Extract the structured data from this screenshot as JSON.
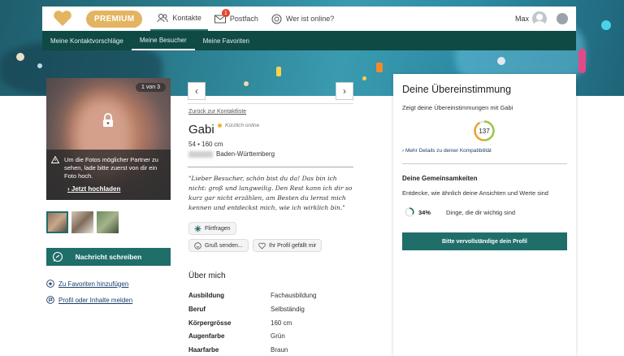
{
  "topnav": {
    "premium_label": "PREMIUM",
    "items": [
      {
        "label": "Kontakte"
      },
      {
        "label": "Postfach",
        "badge": "1"
      },
      {
        "label": "Wer ist online?"
      }
    ],
    "user_name": "Max"
  },
  "subnav": {
    "items": [
      {
        "label": "Meine Kontaktvorschläge"
      },
      {
        "label": "Meine Besucher"
      },
      {
        "label": "Meine Favoriten"
      }
    ]
  },
  "photo": {
    "counter": "1 von 3",
    "info_text": "Um die Fotos möglicher Partner zu sehen, lade bitte zuerst von dir ein Foto hoch.",
    "upload_label": "Jetzt hochladen"
  },
  "actions": {
    "message_button": "Nachricht schreiben",
    "favorite_link": "Zu Favoriten hinzufügen",
    "report_link": "Profil oder Inhalte melden"
  },
  "profile": {
    "back_link": "Zurück zur Kontaktliste",
    "name": "Gabi",
    "status": "Kürzlich online",
    "meta": "54 • 160 cm",
    "location": "Baden-Württemberg",
    "quote": "\"Lieber Besucher, schön bist du da! Das bin ich nicht: groß und langweilig. Den Rest kann ich dir so kurz gar nicht erzählen, am Besten du lernst mich kennen und entdeckst mich, wie ich wirklich bin.\"",
    "chips": {
      "flirt": "Flirtfragen",
      "greet": "Gruß senden...",
      "like": "Ihr Profil gefällt mir"
    },
    "about_heading": "Über mich",
    "details": [
      {
        "key": "Ausbildung",
        "value": "Fachausbildung"
      },
      {
        "key": "Beruf",
        "value": "Selbständig"
      },
      {
        "key": "Körpergrösse",
        "value": "160 cm"
      },
      {
        "key": "Augenfarbe",
        "value": "Grün"
      },
      {
        "key": "Haarfarbe",
        "value": "Braun"
      }
    ]
  },
  "match_panel": {
    "title": "Deine Übereinstimmung",
    "subtitle": "Zeigt deine Übereinstimmungen mit Gabi",
    "score": "137",
    "more_link": "Mehr Details zu deiner Kompatibilität",
    "common_heading": "Deine Gemeinsamkeiten",
    "common_desc": "Entdecke, wie ähnlich deine Ansichten und Werte sind",
    "percent": "34%",
    "percent_text": "Dinge, die dir wichtig sind",
    "percent_value": 0.34,
    "cta": "Bitte vervollständige dein Profil"
  },
  "colors": {
    "brand": "#1f6e6a",
    "premium": "#e3b461",
    "subnav": "#0f4a45"
  }
}
